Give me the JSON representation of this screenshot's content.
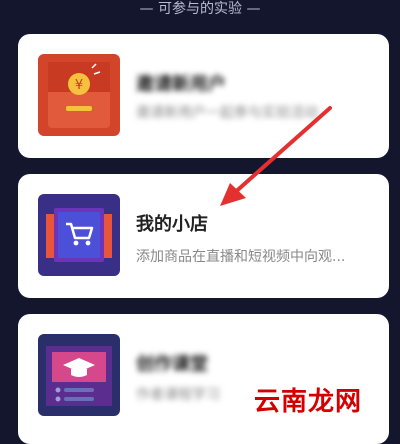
{
  "header": {
    "section_title": "— 可参与的实验 —"
  },
  "experiments": [
    {
      "title": "邀请新用户",
      "desc": "邀请新用户一起参与实验活动",
      "icon": "red-envelope-icon"
    },
    {
      "title": "我的小店",
      "desc": "添加商品在直播和短视频中向观...",
      "icon": "shopping-cart-icon"
    },
    {
      "title": "创作课堂",
      "desc": "作者课程学习",
      "icon": "graduation-cap-icon"
    }
  ],
  "annotation": {
    "arrow_color": "#e53030"
  },
  "watermark": {
    "text": "云南龙网"
  }
}
